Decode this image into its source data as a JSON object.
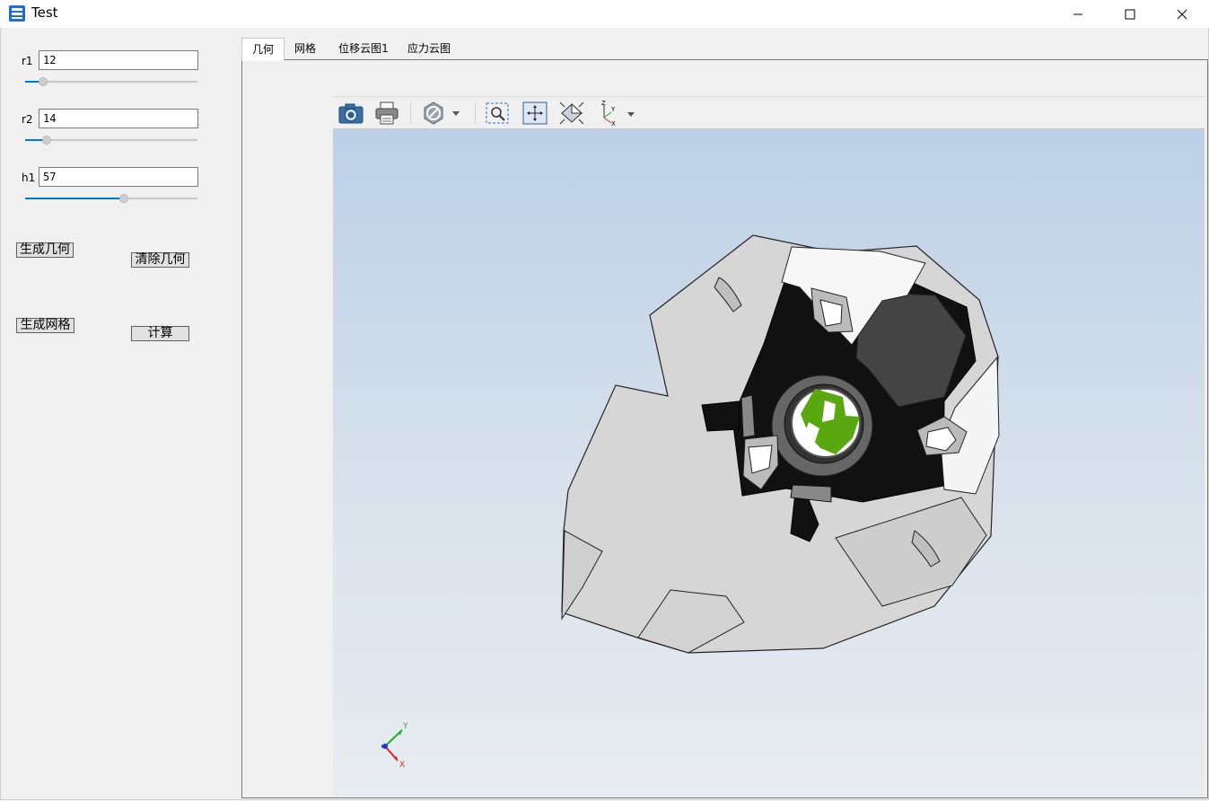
{
  "window": {
    "title": "Test"
  },
  "params": [
    {
      "label": "r1",
      "value": "12",
      "slider_fraction": 0.11
    },
    {
      "label": "r2",
      "value": "14",
      "slider_fraction": 0.13
    },
    {
      "label": "h1",
      "value": "57",
      "slider_fraction": 0.58
    }
  ],
  "buttons": {
    "generate_geometry": "生成几何",
    "clear_geometry": "清除几何",
    "generate_mesh": "生成网格",
    "compute": "计算"
  },
  "tabs": [
    "几何",
    "网格",
    "位移云图1",
    "应力云图"
  ],
  "active_tab": "几何",
  "toolbar": [
    "camera-icon",
    "print-icon",
    "hide-icon",
    "zoom-box-icon",
    "fit-all-icon",
    "iso-view-icon",
    "axes-view-icon"
  ],
  "triad": {
    "x": "X",
    "y": "Y"
  },
  "colors": {
    "accent": "#0078d7",
    "model_dark": "#111111",
    "model_light": "#d8d8d8",
    "highlight": "#5aa80f"
  }
}
